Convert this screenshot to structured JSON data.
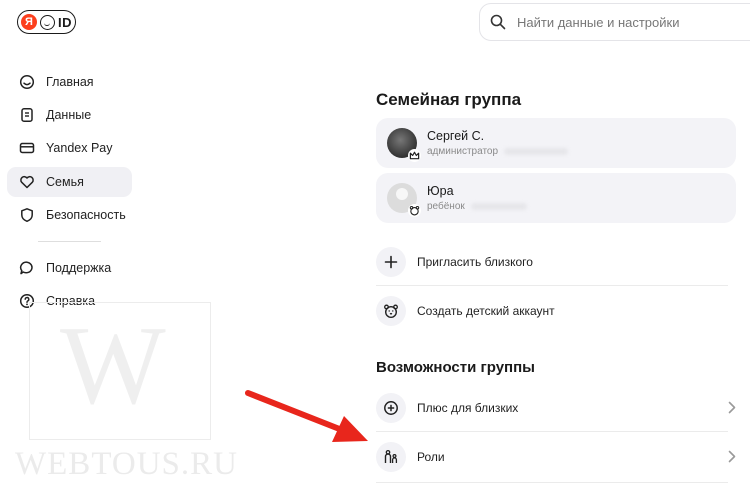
{
  "header": {
    "logo": {
      "mark": "Я",
      "text": "ID"
    },
    "search": {
      "placeholder": "Найти данные и настройки",
      "value": ""
    }
  },
  "sidebar": {
    "items": [
      {
        "label": "Главная",
        "icon": "home-face-icon"
      },
      {
        "label": "Данные",
        "icon": "document-icon"
      },
      {
        "label": "Yandex Pay",
        "icon": "card-icon"
      },
      {
        "label": "Семья",
        "icon": "heart-icon",
        "active": true
      },
      {
        "label": "Безопасность",
        "icon": "shield-icon"
      },
      {
        "label": "Поддержка",
        "icon": "chat-icon"
      },
      {
        "label": "Справка",
        "icon": "help-circle-icon"
      }
    ]
  },
  "watermark": {
    "letter": "W",
    "text": "WEBTOUS.RU"
  },
  "family": {
    "title": "Семейная группа",
    "members": [
      {
        "name": "Сергей С.",
        "role": "администратор",
        "badge": "crown-icon"
      },
      {
        "name": "Юра",
        "role": "ребёнок",
        "badge": "bear-icon"
      }
    ],
    "actions": [
      {
        "label": "Пригласить близкого",
        "icon": "plus-icon"
      },
      {
        "label": "Создать детский аккаунт",
        "icon": "bear-icon"
      }
    ]
  },
  "features": {
    "title": "Возможности группы",
    "items": [
      {
        "label": "Плюс для близких",
        "icon": "plus-circle-icon"
      },
      {
        "label": "Роли",
        "icon": "roles-icon"
      }
    ]
  },
  "colors": {
    "brand": "#fc3f1d",
    "annotation_arrow": "#e8261c",
    "active_bg": "#f0f0f4"
  }
}
